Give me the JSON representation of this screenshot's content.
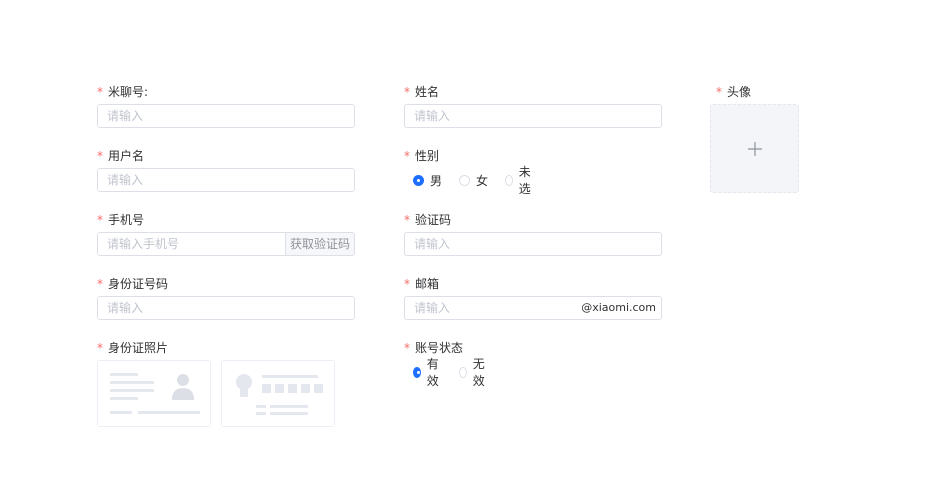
{
  "form": {
    "required_mark": "*",
    "mliao": {
      "label": "米聊号:",
      "placeholder": "请输入"
    },
    "name": {
      "label": "姓名",
      "placeholder": "请输入"
    },
    "avatar": {
      "label": "头像",
      "icon": "plus-icon"
    },
    "username": {
      "label": "用户名",
      "placeholder": "请输入"
    },
    "gender": {
      "label": "性别",
      "options": [
        {
          "label": "男",
          "checked": true
        },
        {
          "label": "女",
          "checked": false
        },
        {
          "label": "未选",
          "checked": false
        }
      ]
    },
    "phone": {
      "label": "手机号",
      "placeholder": "请输入手机号",
      "button": "获取验证码"
    },
    "code": {
      "label": "验证码",
      "placeholder": "请输入"
    },
    "idnumber": {
      "label": "身份证号码",
      "placeholder": "请输入"
    },
    "email": {
      "label": "邮箱",
      "placeholder": "请输入",
      "suffix": "@xiaomi.com"
    },
    "idphoto": {
      "label": "身份证照片",
      "front_icon": "id-card-front-icon",
      "back_icon": "id-card-back-icon"
    },
    "status": {
      "label": "账号状态",
      "options": [
        {
          "label": "有效",
          "checked": true
        },
        {
          "label": "无效",
          "checked": false
        }
      ]
    }
  },
  "colors": {
    "primary": "#1e6fff",
    "required": "#f56c6c",
    "border": "#dcdfe6",
    "placeholder": "#c0c4cc"
  }
}
